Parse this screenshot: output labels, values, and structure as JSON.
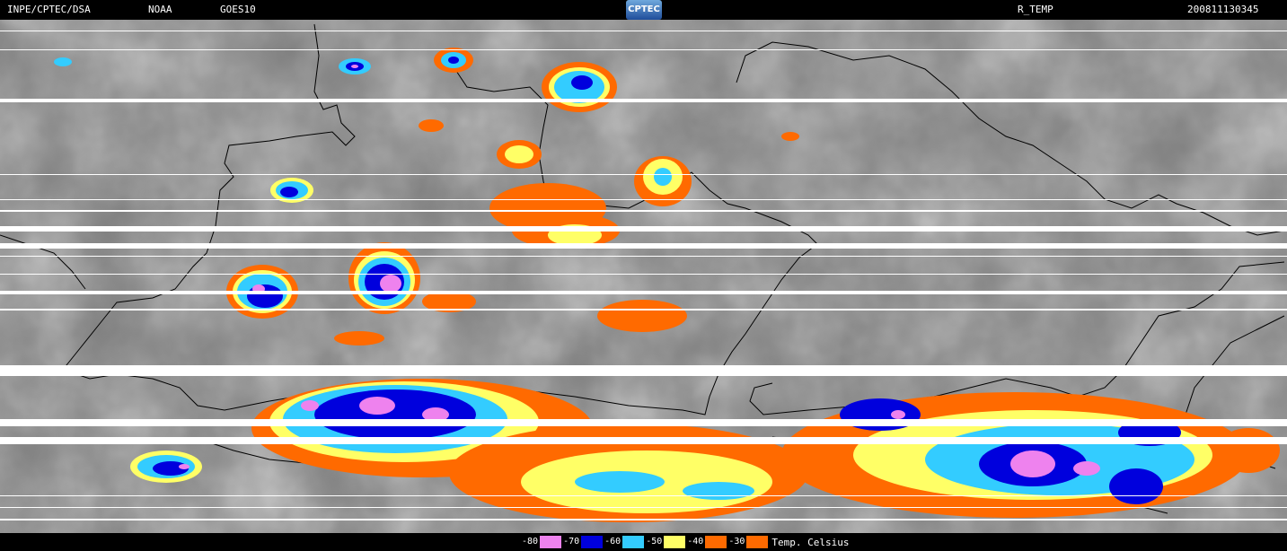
{
  "header": {
    "left_label": "INPE/CPTEC/DSA",
    "agency": "NOAA",
    "satellite": "GOES10",
    "logo_text": "CPTEC",
    "product": "R_TEMP",
    "timestamp": "200811130345"
  },
  "colors": {
    "background": "#000000",
    "cloud_gray": "#8a8a8a",
    "coastline": "#000000",
    "scanline": "#ffffff"
  },
  "legend": {
    "unit": "Temp. Celsius",
    "items": [
      {
        "label": "-80",
        "color": "#ee82ee"
      },
      {
        "label": "-70",
        "color": "#0000dd"
      },
      {
        "label": "-60",
        "color": "#33ccff"
      },
      {
        "label": "-50",
        "color": "#ffff66"
      },
      {
        "label": "-40",
        "color": "#ff6a00"
      },
      {
        "label": "-30",
        "color": "#ff6a00"
      }
    ]
  }
}
